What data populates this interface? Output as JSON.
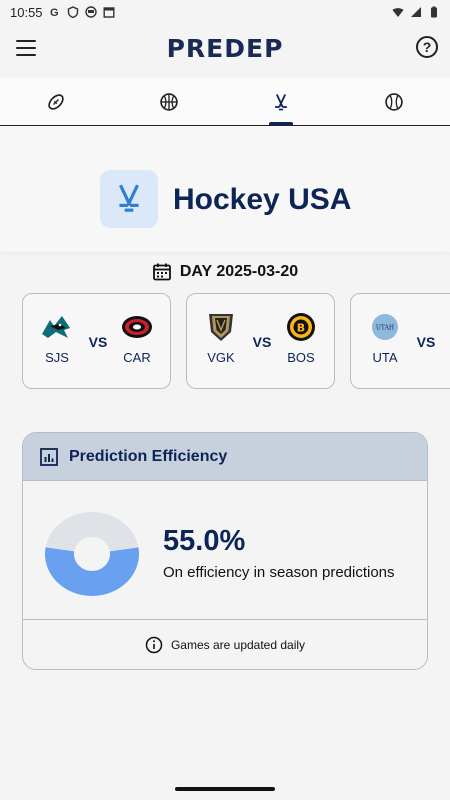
{
  "status": {
    "time": "10:55",
    "icons": [
      "google-icon",
      "shield-icon",
      "face-icon",
      "calendar-icon"
    ],
    "right_icons": [
      "wifi-icon",
      "signal-icon",
      "battery-icon"
    ]
  },
  "app": {
    "logo": "PREDEP",
    "menu_icon": "menu-icon",
    "help_icon": "help-icon"
  },
  "tabs": [
    {
      "name": "football",
      "icon": "football-icon",
      "active": false
    },
    {
      "name": "basketball",
      "icon": "basketball-icon",
      "active": false
    },
    {
      "name": "hockey",
      "icon": "hockey-icon",
      "active": true
    },
    {
      "name": "baseball",
      "icon": "baseball-icon",
      "active": false
    }
  ],
  "league": {
    "title": "Hockey USA"
  },
  "day": {
    "label": "DAY 2025-03-20"
  },
  "games": [
    {
      "home": "SJS",
      "away": "CAR",
      "vs": "VS"
    },
    {
      "home": "VGK",
      "away": "BOS",
      "vs": "VS"
    },
    {
      "home": "UTA",
      "away": "",
      "vs": "VS",
      "home_logo_text": "UTAH"
    }
  ],
  "efficiency": {
    "title": "Prediction Efficiency",
    "value": "55.0%",
    "fraction": 0.55,
    "subtitle": "On efficiency in season predictions",
    "footer": "Games are updated daily",
    "colors": {
      "filled": "#6aa0f0",
      "empty": "#dfe3e8"
    }
  }
}
